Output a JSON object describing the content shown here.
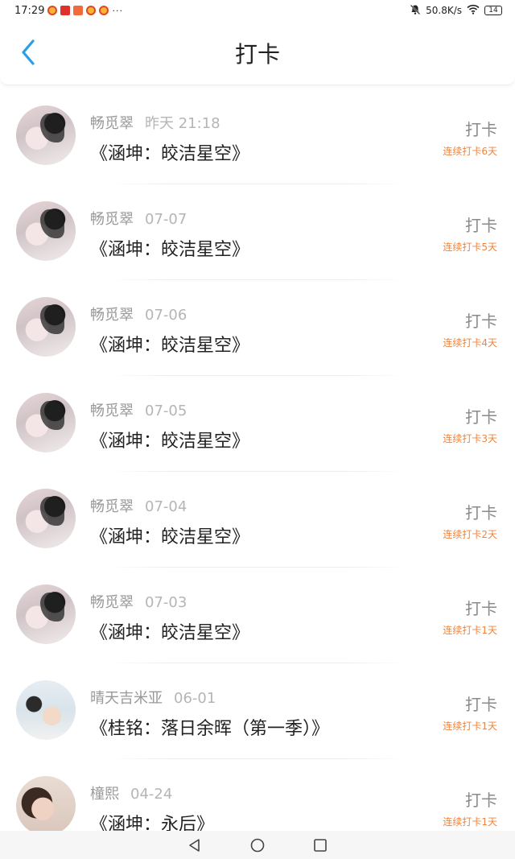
{
  "status_bar": {
    "time": "17:29",
    "dots": "···",
    "net_speed": "50.8K/s",
    "battery": "14"
  },
  "header": {
    "title": "打卡"
  },
  "items": [
    {
      "user": "畅觅翠",
      "time": "昨天 21:18",
      "book": "《涵坤：皎洁星空》",
      "action": "打卡",
      "streak": "连续打卡6天"
    },
    {
      "user": "畅觅翠",
      "time": "07-07",
      "book": "《涵坤：皎洁星空》",
      "action": "打卡",
      "streak": "连续打卡5天"
    },
    {
      "user": "畅觅翠",
      "time": "07-06",
      "book": "《涵坤：皎洁星空》",
      "action": "打卡",
      "streak": "连续打卡4天"
    },
    {
      "user": "畅觅翠",
      "time": "07-05",
      "book": "《涵坤：皎洁星空》",
      "action": "打卡",
      "streak": "连续打卡3天"
    },
    {
      "user": "畅觅翠",
      "time": "07-04",
      "book": "《涵坤：皎洁星空》",
      "action": "打卡",
      "streak": "连续打卡2天"
    },
    {
      "user": "畅觅翠",
      "time": "07-03",
      "book": "《涵坤：皎洁星空》",
      "action": "打卡",
      "streak": "连续打卡1天"
    },
    {
      "user": "晴天吉米亚",
      "time": "06-01",
      "book": "《桂铭：落日余晖（第一季）》",
      "action": "打卡",
      "streak": "连续打卡1天"
    },
    {
      "user": "橦熙",
      "time": "04-24",
      "book": "《涵坤：永后》",
      "action": "打卡",
      "streak": "连续打卡1天"
    }
  ],
  "colors": {
    "accent": "#2c9ee8",
    "streak": "#f0833a"
  }
}
